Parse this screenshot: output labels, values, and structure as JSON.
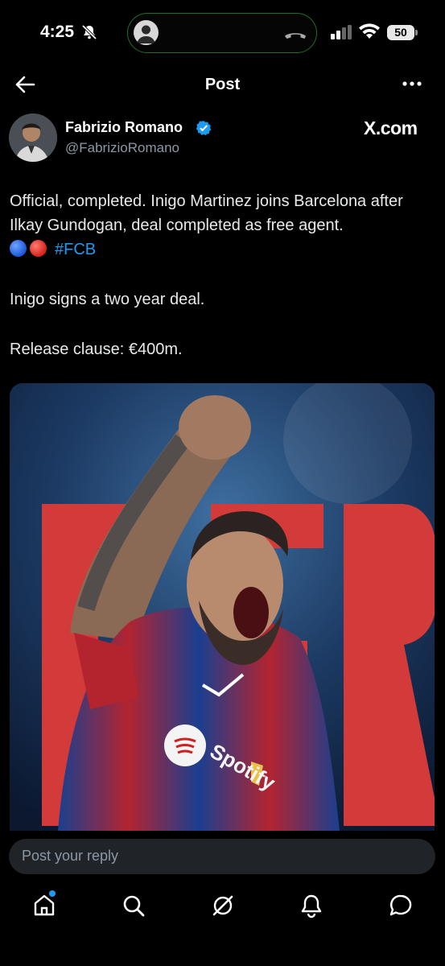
{
  "status_bar": {
    "time": "4:25",
    "battery": "50"
  },
  "nav": {
    "title": "Post"
  },
  "author": {
    "name": "Fabrizio Romano",
    "handle": "@FabrizioRomano",
    "source": "X.com"
  },
  "tweet": {
    "line1": "Official, completed. Inigo Martinez joins Barcelona after Ilkay Gundogan, deal completed as free agent.",
    "hashtag": "#FCB",
    "line2": "Inigo signs a two year deal.",
    "line3": "Release clause: €400m."
  },
  "media": {
    "brand_text": "Spotify"
  },
  "reply": {
    "placeholder": "Post your reply"
  },
  "tabbar": {
    "items": [
      "home-icon",
      "search-icon",
      "grok-icon",
      "notifications-icon",
      "messages-icon"
    ]
  },
  "colors": {
    "accent": "#1d9bf0",
    "background": "#000000",
    "text": "#e7e9ea",
    "muted": "#8b98a5"
  }
}
